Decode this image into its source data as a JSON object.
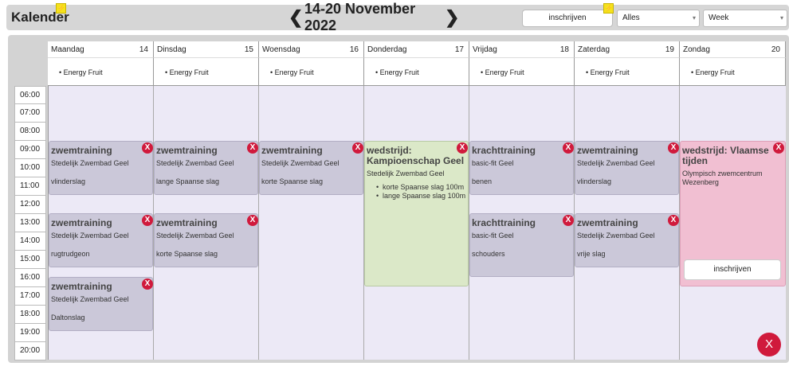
{
  "header": {
    "title": "Kalender",
    "week_label": "14-20 November 2022",
    "register_label": "inschrijven",
    "filter_select": "Alles",
    "view_select": "Week",
    "icons": {
      "prev": "chevron-left-icon",
      "next": "chevron-right-icon",
      "badge": "lightning-icon"
    }
  },
  "days": [
    {
      "name": "Maandag",
      "num": "14",
      "allday": "Energy Fruit"
    },
    {
      "name": "Dinsdag",
      "num": "15",
      "allday": "Energy Fruit"
    },
    {
      "name": "Woensdag",
      "num": "16",
      "allday": "Energy Fruit"
    },
    {
      "name": "Donderdag",
      "num": "17",
      "allday": "Energy Fruit"
    },
    {
      "name": "Vrijdag",
      "num": "18",
      "allday": "Energy Fruit"
    },
    {
      "name": "Zaterdag",
      "num": "19",
      "allday": "Energy Fruit"
    },
    {
      "name": "Zondag",
      "num": "20",
      "allday": "Energy Fruit"
    }
  ],
  "hours": [
    "06:00",
    "07:00",
    "08:00",
    "09:00",
    "10:00",
    "11:00",
    "12:00",
    "13:00",
    "14:00",
    "15:00",
    "16:00",
    "17:00",
    "18:00",
    "19:00",
    "20:00"
  ],
  "events": {
    "mon1": {
      "title": "zwemtraining",
      "loc": "Stedelijk Zwembad Geel",
      "detail": "vlinderslag"
    },
    "mon2": {
      "title": "zwemtraining",
      "loc": "Stedelijk Zwembad Geel",
      "detail": "rugtrudgeon"
    },
    "mon3": {
      "title": "zwemtraining",
      "loc": "Stedelijk Zwembad Geel",
      "detail": "Daltonslag"
    },
    "tue1": {
      "title": "zwemtraining",
      "loc": "Stedelijk Zwembad Geel",
      "detail": "lange Spaanse slag"
    },
    "tue2": {
      "title": "zwemtraining",
      "loc": "Stedelijk Zwembad Geel",
      "detail": "korte Spaanse slag"
    },
    "wed1": {
      "title": "zwemtraining",
      "loc": "Stedelijk Zwembad Geel",
      "detail": "korte Spaanse slag"
    },
    "thu1": {
      "title": "wedstrijd: Kampioenschap Geel",
      "loc": "Stedelijk Zwembad Geel",
      "items": [
        "korte Spaanse slag 100m",
        "lange Spaanse slag 100m"
      ]
    },
    "fri1": {
      "title": "krachttraining",
      "loc": "basic-fit Geel",
      "detail": "benen"
    },
    "fri2": {
      "title": "krachttraining",
      "loc": "basic-fit Geel",
      "detail": "schouders"
    },
    "sat1": {
      "title": "zwemtraining",
      "loc": "Stedelijk Zwembad Geel",
      "detail": "vlinderslag"
    },
    "sat2": {
      "title": "zwemtraining",
      "loc": "Stedelijk Zwembad Geel",
      "detail": "vrije slag"
    },
    "sun1": {
      "title": "wedstrijd: Vlaamse tijden",
      "loc": "Olympisch zwemcentrum Wezenberg",
      "register_label": "inschrijven"
    }
  },
  "remove_glyph": "X",
  "colors": {
    "training": "#cbc8d9",
    "competition_open": "#dbe8c8",
    "competition_pink": "#f1bfd2",
    "remove": "#d01a3c",
    "grid": "#ece9f6"
  }
}
